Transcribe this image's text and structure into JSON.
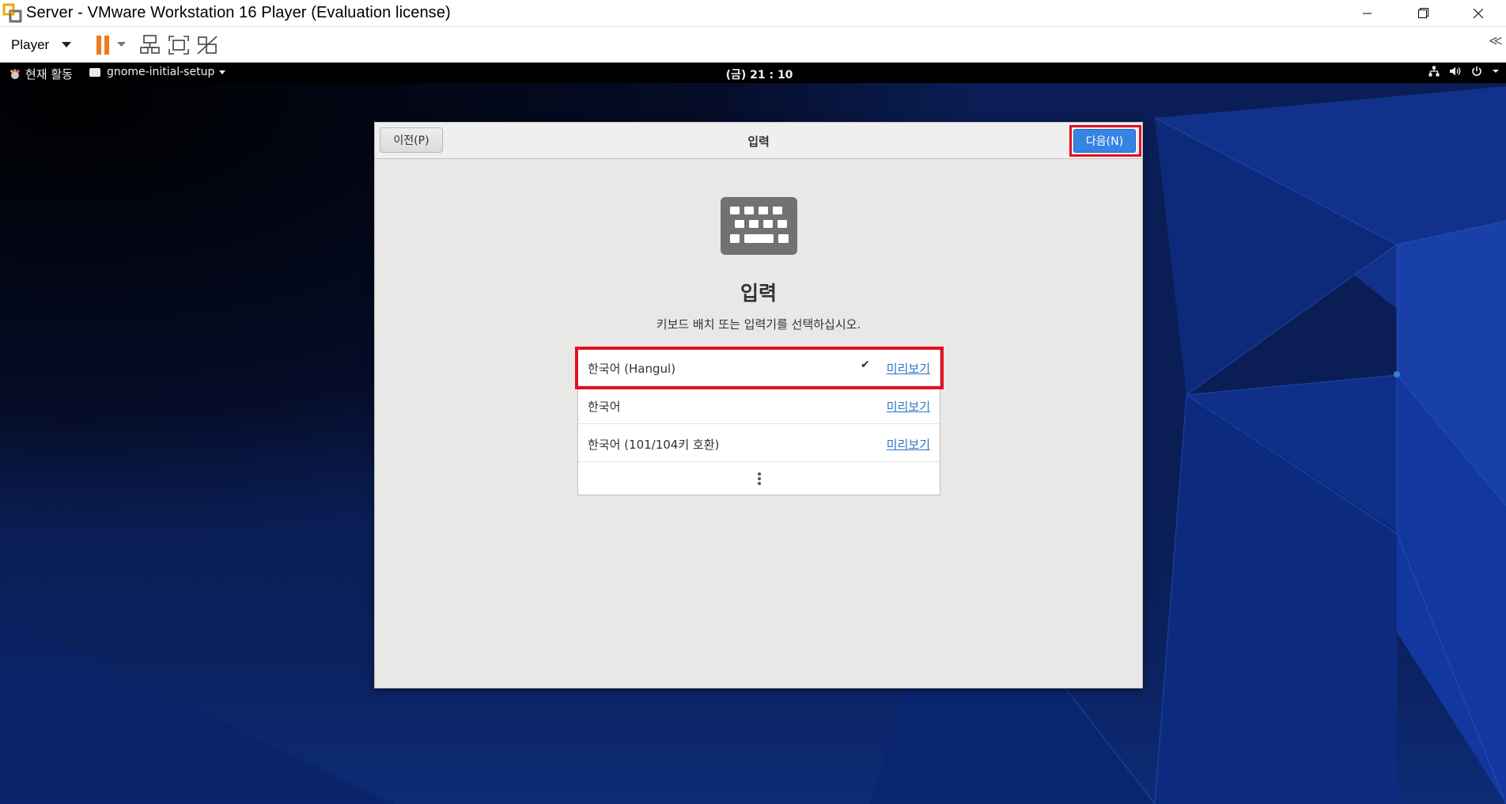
{
  "window": {
    "title": "Server - VMware Workstation 16 Player (Evaluation license)"
  },
  "toolbar": {
    "player_label": "Player",
    "collapse_label": "≪"
  },
  "gnome_bar": {
    "activities_label": "현재 활동",
    "app_menu_label": "gnome-initial-setup",
    "clock": "(금) 21 : 10"
  },
  "dialog": {
    "prev_label": "이전(P)",
    "title": "입력",
    "next_label": "다음(N)",
    "heading": "입력",
    "subtitle": "키보드 배치 또는 입력기를 선택하십시오."
  },
  "languages": [
    {
      "name": "한국어 (Hangul)",
      "selected": true,
      "preview_label": "미리보기"
    },
    {
      "name": "한국어",
      "selected": false,
      "preview_label": "미리보기"
    },
    {
      "name": "한국어 (101/104키 호환)",
      "selected": false,
      "preview_label": "미리보기"
    }
  ],
  "colors": {
    "accent_blue": "#3584e4",
    "highlight_red": "#e3101f",
    "pause_orange": "#f07a1e",
    "link_blue": "#2a76c6"
  }
}
